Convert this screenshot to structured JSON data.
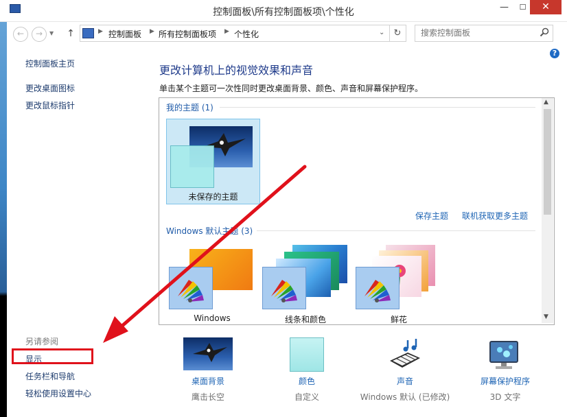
{
  "window": {
    "title": "控制面板\\所有控制面板项\\个性化",
    "minimize": "—",
    "maximize": "☐",
    "close": "✕"
  },
  "nav": {
    "back": "←",
    "forward": "→",
    "up": "↑",
    "refresh": "↻",
    "breadcrumbs": [
      "控制面板",
      "所有控制面板项",
      "个性化"
    ],
    "search_placeholder": "搜索控制面板",
    "help": "?"
  },
  "sidebar": {
    "links": [
      "控制面板主页",
      "更改桌面图标",
      "更改鼠标指针"
    ],
    "see_also": "另请参阅",
    "see_also_links": [
      "显示",
      "任务栏和导航",
      "轻松使用设置中心"
    ]
  },
  "main": {
    "heading": "更改计算机上的视觉效果和声音",
    "description": "单击某个主题可一次性同时更改桌面背景、颜色、声音和屏幕保护程序。",
    "my_themes_label": "我的主题 (1)",
    "unsaved_theme": "未保存的主题",
    "save_theme": "保存主题",
    "get_more_themes": "联机获取更多主题",
    "default_themes_label": "Windows 默认主题 (3)",
    "default_themes": [
      "Windows",
      "线条和颜色",
      "鲜花"
    ]
  },
  "bottom": [
    {
      "label": "桌面背景",
      "sub": "鹰击长空"
    },
    {
      "label": "颜色",
      "sub": "自定义"
    },
    {
      "label": "声音",
      "sub": "Windows 默认 (已修改)"
    },
    {
      "label": "屏幕保护程序",
      "sub": "3D 文字"
    }
  ],
  "colors": {
    "link_blue": "#1e64b4",
    "heading_blue": "#1e3a8a",
    "annotation_red": "#e0111b",
    "selection_blue": "#cce8f6"
  }
}
